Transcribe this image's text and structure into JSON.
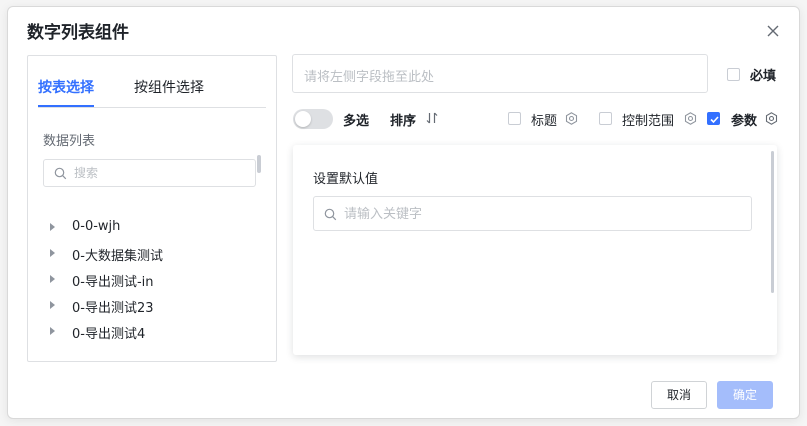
{
  "dialog": {
    "title": "数字列表组件"
  },
  "left_panel": {
    "tabs": [
      {
        "label": "按表选择",
        "active": true
      },
      {
        "label": "按组件选择",
        "active": false
      }
    ],
    "list_title": "数据列表",
    "search_placeholder": "搜索",
    "tree_items": [
      "0-0-wjh",
      "0-大数据集测试",
      "0-导出测试-in",
      "0-导出测试23",
      "0-导出测试4"
    ]
  },
  "right": {
    "drop_placeholder": "请将左侧字段拖至此处",
    "required": {
      "label": "必填",
      "checked": false
    },
    "multi_select": {
      "label": "多选",
      "on": false
    },
    "sort_label": "排序",
    "options": [
      {
        "label": "标题",
        "checked": false
      },
      {
        "label": "控制范围",
        "checked": false
      },
      {
        "label": "参数",
        "checked": true
      }
    ],
    "default_value": {
      "title": "设置默认值",
      "placeholder": "请输入关键字"
    }
  },
  "footer": {
    "cancel_label": "取消",
    "ok_label": "确定"
  },
  "colors": {
    "accent": "#3370ff",
    "ok_disabled": "#a4bdfb"
  }
}
